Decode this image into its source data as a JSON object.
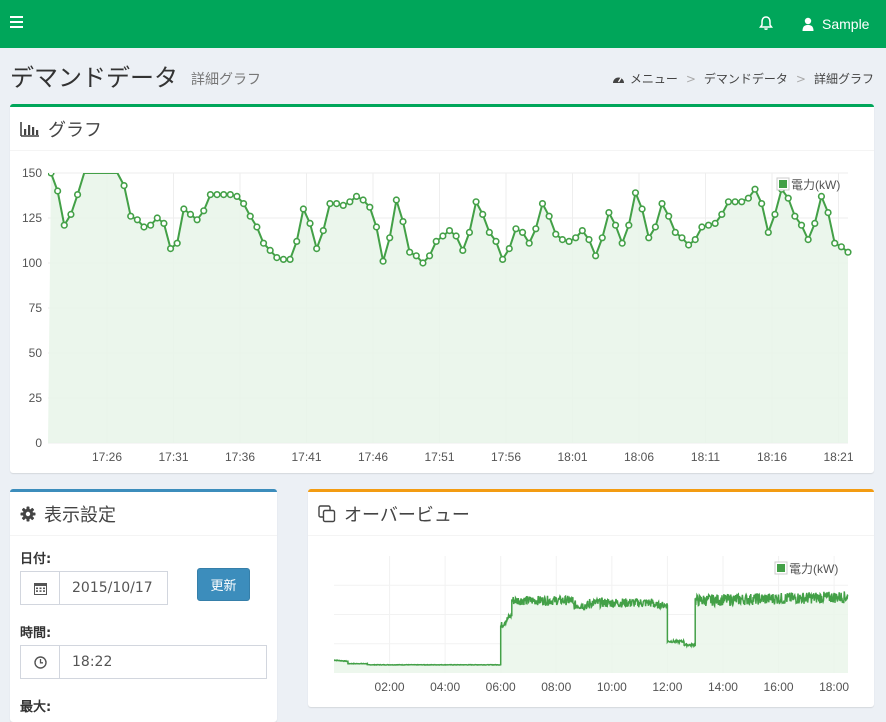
{
  "header": {
    "user_name": "Sample"
  },
  "page": {
    "title": "デマンドデータ",
    "subtitle": "詳細グラフ"
  },
  "breadcrumb": {
    "items": [
      "メニュー",
      "デマンドデータ",
      "詳細グラフ"
    ],
    "separator": ">"
  },
  "graph_box": {
    "title": "グラフ"
  },
  "settings_box": {
    "title": "表示設定",
    "date_label": "日付:",
    "date_value": "2015/10/17",
    "update_button": "更新",
    "time_label": "時間:",
    "time_value": "18:22",
    "max_label": "最大:"
  },
  "overview_box": {
    "title": "オーバービュー"
  },
  "colors": {
    "header_green": "#00a65a",
    "series_green": "#43a047",
    "fill_green": "#e8f5e9",
    "primary_blue": "#3c8dbc",
    "warning_orange": "#f39c12"
  },
  "chart_data": [
    {
      "type": "line",
      "series": [
        {
          "name": "電力(kW)",
          "values": [
            150,
            140,
            121,
            127,
            138,
            155,
            165,
            170,
            175,
            160,
            153,
            143,
            126,
            124,
            120,
            121,
            125,
            122,
            108,
            111,
            130,
            127,
            124,
            129,
            138,
            138,
            138,
            138,
            137,
            133,
            126,
            120,
            111,
            107,
            103,
            102,
            102,
            112,
            130,
            122,
            108,
            118,
            133,
            133,
            132,
            134,
            137,
            135,
            131,
            120,
            101,
            114,
            135,
            123,
            106,
            104,
            100,
            104,
            112,
            115,
            118,
            115,
            107,
            117,
            134,
            127,
            117,
            112,
            102,
            108,
            119,
            117,
            111,
            119,
            133,
            126,
            116,
            113,
            112,
            114,
            118,
            113,
            104,
            114,
            128,
            121,
            111,
            121,
            139,
            130,
            114,
            120,
            133,
            126,
            117,
            114,
            110,
            113,
            120,
            121,
            122,
            127,
            134,
            134,
            134,
            136,
            141,
            133,
            117,
            127,
            141,
            136,
            126,
            121,
            113,
            122,
            137,
            128,
            111,
            109,
            106
          ]
        }
      ],
      "x_tick_labels": [
        "17:26",
        "17:31",
        "17:36",
        "17:41",
        "17:46",
        "17:51",
        "17:56",
        "18:01",
        "18:06",
        "18:11",
        "18:16",
        "18:21"
      ],
      "y_tick_labels": [
        "0",
        "25",
        "50",
        "75",
        "100",
        "125",
        "150"
      ],
      "ylim": [
        0,
        150
      ],
      "grid": true,
      "legend": "top-right",
      "fill": true
    },
    {
      "type": "area",
      "series": [
        {
          "name": "電力(kW)",
          "segments": [
            {
              "from": 0.0,
              "to": 0.5,
              "start": 11,
              "end": 10,
              "noise": 0.3
            },
            {
              "from": 0.5,
              "to": 1.2,
              "start": 8,
              "end": 8,
              "noise": 0.2
            },
            {
              "from": 1.2,
              "to": 6.0,
              "start": 7,
              "end": 7,
              "noise": 0.2
            },
            {
              "from": 6.0,
              "to": 6.4,
              "start": 40,
              "end": 50,
              "noise": 3
            },
            {
              "from": 6.4,
              "to": 8.6,
              "start": 62,
              "end": 62,
              "noise": 4
            },
            {
              "from": 8.6,
              "to": 9.2,
              "start": 58,
              "end": 58,
              "noise": 4
            },
            {
              "from": 9.2,
              "to": 11.5,
              "start": 60,
              "end": 60,
              "noise": 4
            },
            {
              "from": 11.5,
              "to": 12.0,
              "start": 58,
              "end": 58,
              "noise": 3
            },
            {
              "from": 12.0,
              "to": 12.6,
              "start": 27,
              "end": 27,
              "noise": 1
            },
            {
              "from": 12.6,
              "to": 13.0,
              "start": 24,
              "end": 24,
              "noise": 1
            },
            {
              "from": 13.0,
              "to": 18.5,
              "start": 62,
              "end": 65,
              "noise": 5
            }
          ]
        }
      ],
      "x_tick_labels": [
        "02:00",
        "04:00",
        "06:00",
        "08:00",
        "10:00",
        "12:00",
        "14:00",
        "16:00",
        "18:00"
      ],
      "grid": true,
      "legend": "top-right",
      "fill": true
    }
  ]
}
